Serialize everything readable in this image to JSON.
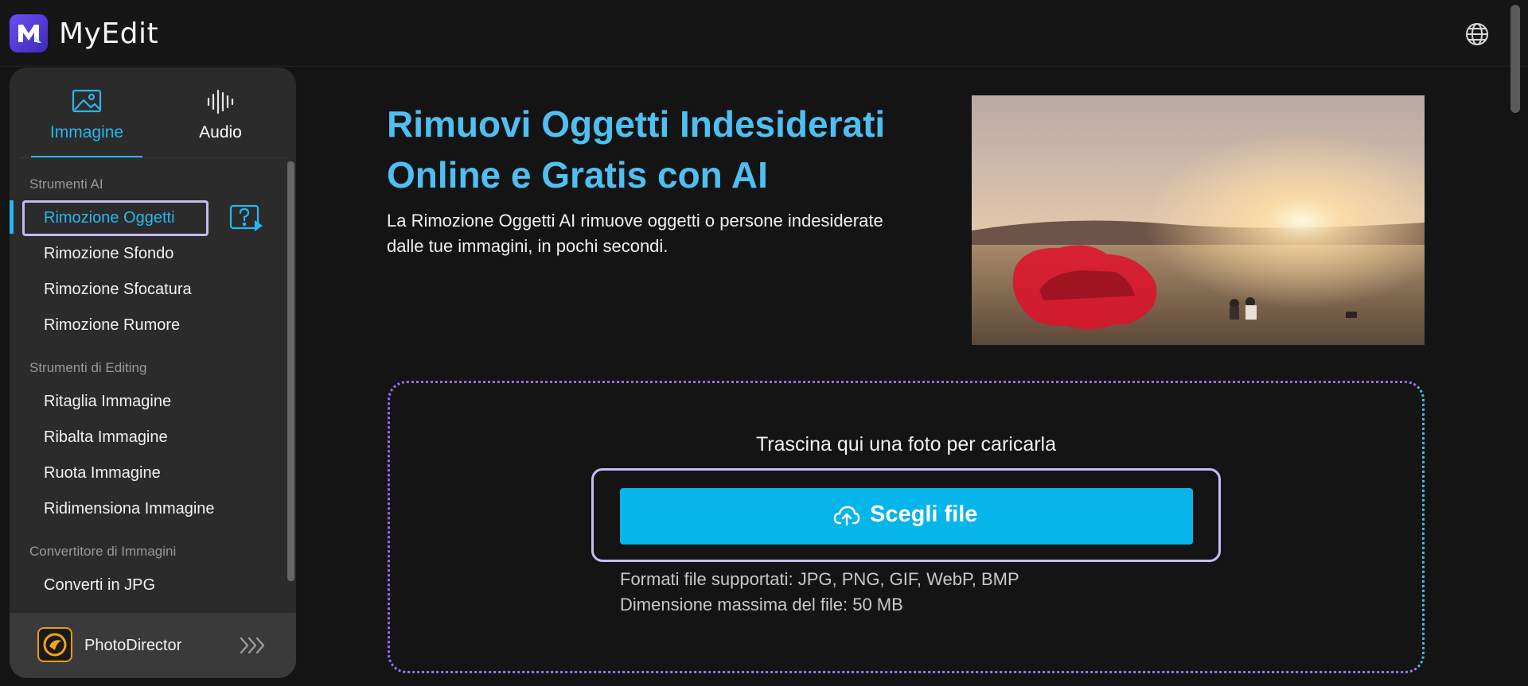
{
  "header": {
    "app_name": "MyEdit",
    "logo_icon": "myedit-logo-icon",
    "language_icon": "globe-icon"
  },
  "sidebar": {
    "tabs": [
      {
        "label": "Immagine",
        "icon": "image-icon",
        "active": true
      },
      {
        "label": "Audio",
        "icon": "waveform-icon",
        "active": false
      }
    ],
    "sections": [
      {
        "title": "Strumenti AI",
        "items": [
          "Rimozione Oggetti",
          "Rimozione Sfondo",
          "Rimozione Sfocatura",
          "Rimozione Rumore"
        ]
      },
      {
        "title": "Strumenti di Editing",
        "items": [
          "Ritaglia Immagine",
          "Ribalta Immagine",
          "Ruota Immagine",
          "Ridimensiona Immagine"
        ]
      },
      {
        "title": "Convertitore di Immagini",
        "items": [
          "Converti in JPG"
        ]
      }
    ],
    "active_item": "Rimozione Oggetti",
    "help_icon": "help-video-icon",
    "promo": {
      "label": "PhotoDirector",
      "icon": "photodirector-icon",
      "arrow_icon": "triple-chevron-right-icon"
    }
  },
  "main": {
    "title_line1": "Rimuovi Oggetti Indesiderati",
    "title_line2": "Online e Gratis con AI",
    "description_line1": "La Rimozione Oggetti AI rimuove oggetti o persone indesiderate",
    "description_line2": "dalle tue immagini, in pochi secondi.",
    "upload": {
      "hint": "Trascina qui una foto per caricarla",
      "button_label": "Scegli file",
      "button_icon": "cloud-upload-icon",
      "formats": "Formati file supportati: JPG, PNG, GIF, WebP, BMP",
      "max_size": "Dimensione massima del file: 50 MB"
    }
  },
  "colors": {
    "accent": "#27b7ee",
    "button": "#06b5ea",
    "title": "#4fbff2",
    "focus_outline": "#c9bcf5",
    "background": "#141414",
    "sidebar": "#2b2b2b"
  }
}
